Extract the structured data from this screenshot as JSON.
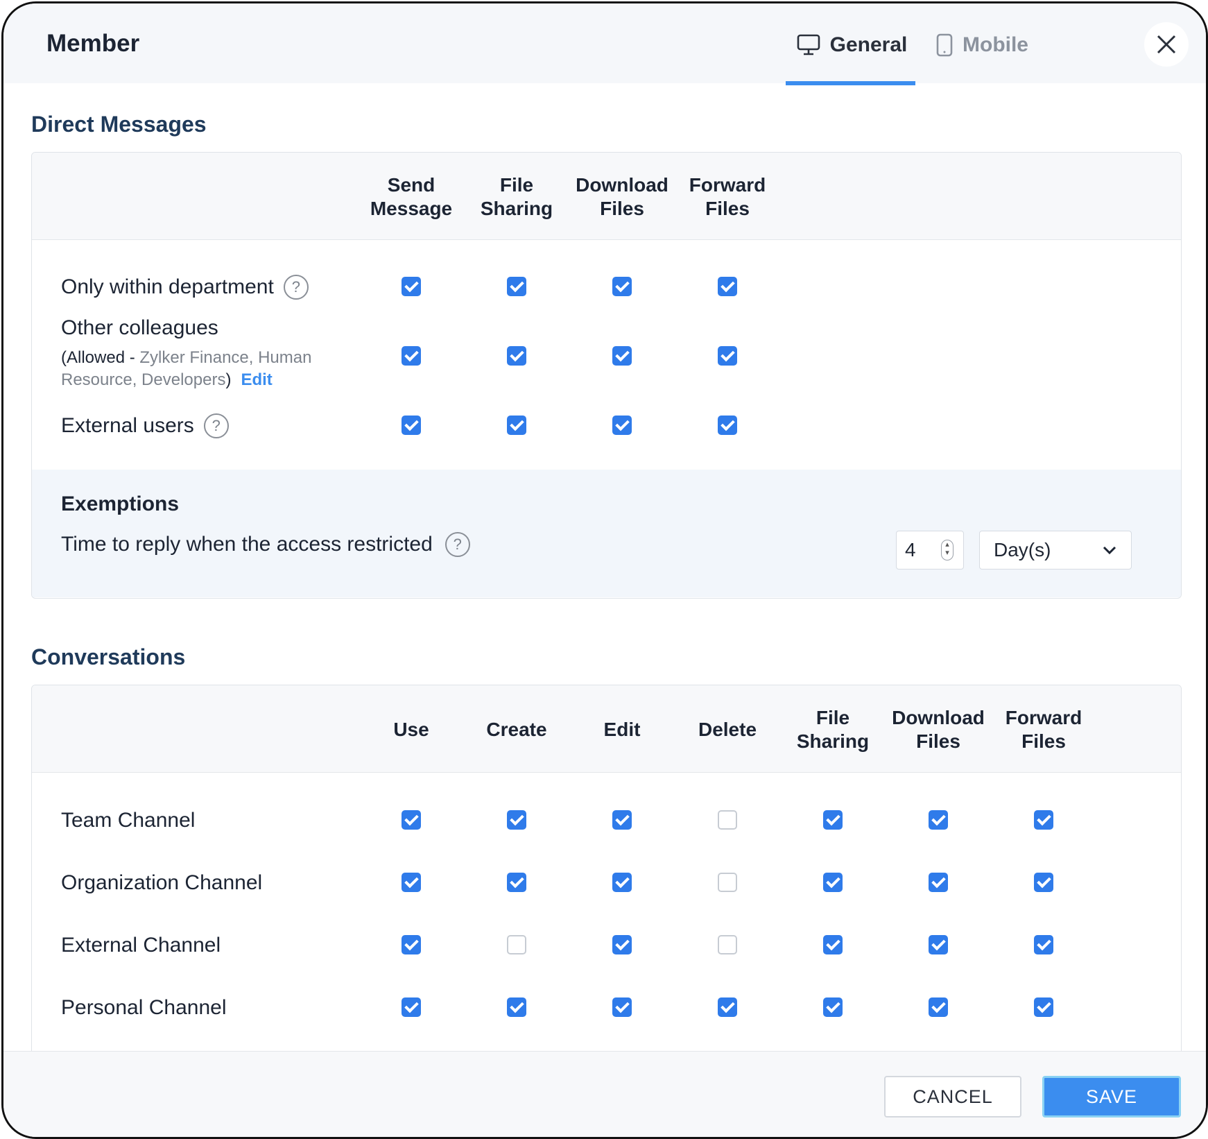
{
  "dialog": {
    "title": "Member",
    "tabs": [
      {
        "label": "General",
        "icon": "desktop-icon",
        "active": true
      },
      {
        "label": "Mobile",
        "icon": "mobile-icon",
        "active": false
      }
    ],
    "close_icon": "close-icon"
  },
  "direct_messages": {
    "title": "Direct Messages",
    "columns": [
      [
        "Send",
        "Message"
      ],
      [
        "File",
        "Sharing"
      ],
      [
        "Download",
        "Files"
      ],
      [
        "Forward",
        "Files"
      ]
    ],
    "rows": [
      {
        "label": "Only within department",
        "help": "?",
        "checks": [
          true,
          true,
          true,
          true
        ]
      },
      {
        "label": "Other colleagues",
        "allowed_prefix": "(Allowed - ",
        "allowed_list_1": "Zylker Finance, Human",
        "allowed_list_2": "Resource, Developers",
        "allowed_suffix": ")",
        "edit": "Edit",
        "checks": [
          true,
          true,
          true,
          true
        ]
      },
      {
        "label": "External users",
        "help": "?",
        "checks": [
          true,
          true,
          true,
          true
        ]
      }
    ],
    "exemptions": {
      "title": "Exemptions",
      "label": "Time to reply when the access restricted",
      "help": "?",
      "value": "4",
      "unit": "Day(s)"
    }
  },
  "conversations": {
    "title": "Conversations",
    "columns": [
      [
        "Use"
      ],
      [
        "Create"
      ],
      [
        "Edit"
      ],
      [
        "Delete"
      ],
      [
        "File",
        "Sharing"
      ],
      [
        "Download",
        "Files"
      ],
      [
        "Forward",
        "Files"
      ]
    ],
    "rows": [
      {
        "label": "Team Channel",
        "checks": [
          true,
          true,
          true,
          false,
          true,
          true,
          true
        ]
      },
      {
        "label": "Organization Channel",
        "checks": [
          true,
          true,
          true,
          false,
          true,
          true,
          true
        ]
      },
      {
        "label": "External Channel",
        "checks": [
          true,
          false,
          true,
          false,
          true,
          true,
          true
        ]
      },
      {
        "label": "Personal Channel",
        "checks": [
          true,
          true,
          true,
          true,
          true,
          true,
          true
        ]
      }
    ]
  },
  "footer": {
    "cancel": "CANCEL",
    "save": "SAVE"
  },
  "colors": {
    "accent": "#3b8def",
    "checkbox_checked": "#2f7bea",
    "section_title": "#1f3a5a"
  }
}
